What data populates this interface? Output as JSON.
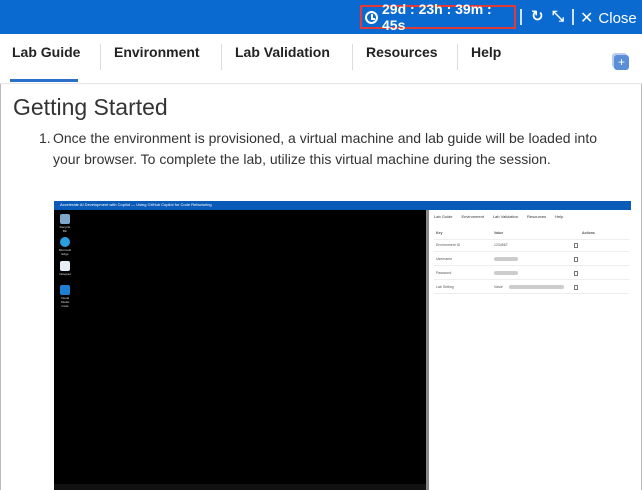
{
  "topbar": {
    "timer": "29d : 23h : 39m : 45s",
    "close_label": "Close",
    "icons": [
      "clock-icon",
      "refresh-icon",
      "collapse-icon",
      "close-icon"
    ],
    "accent_color": "#0a6ad0"
  },
  "tabs": [
    {
      "label": "Lab Guide",
      "active": true
    },
    {
      "label": "Environment",
      "active": false
    },
    {
      "label": "Lab Validation",
      "active": false
    },
    {
      "label": "Resources",
      "active": false
    },
    {
      "label": "Help",
      "active": false
    }
  ],
  "main": {
    "heading": "Getting Started",
    "step_number": "1.",
    "step_text": "Once the environment is provisioned, a virtual machine and lab guide will be loaded into your browser. To complete the lab, utilize this virtual machine during the session."
  },
  "screenshot": {
    "title": "Accelerate AI Development with Copilot — Using GitHub Copilot for Code Refactoring",
    "desktop_icons": [
      "Recycle Bin",
      "Microsoft Edge",
      "Notepad",
      "Visual Studio Code"
    ],
    "panel_tabs": [
      "Lab Guide",
      "Environment",
      "Lab Validation",
      "Resources",
      "Help"
    ],
    "panel_headers": [
      "Key",
      "Value",
      "Actions"
    ],
    "panel_rows": [
      {
        "key": "Environment ID",
        "value": "1234567"
      },
      {
        "key": "Username",
        "value": ""
      },
      {
        "key": "Password",
        "value": ""
      },
      {
        "key": "Lab Setting",
        "value": "Value"
      }
    ]
  }
}
